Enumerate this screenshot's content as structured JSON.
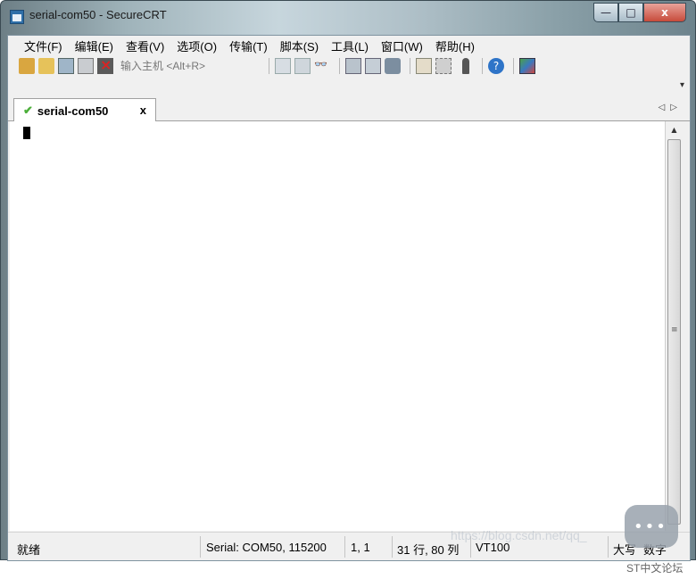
{
  "window": {
    "title": "serial-com50 - SecureCRT",
    "controls": {
      "minimize": "—",
      "maximize": "□",
      "close": "x"
    }
  },
  "menubar": {
    "items": [
      "文件(F)",
      "编辑(E)",
      "查看(V)",
      "选项(O)",
      "传输(T)",
      "脚本(S)",
      "工具(L)",
      "窗口(W)",
      "帮助(H)"
    ]
  },
  "toolbar": {
    "host_placeholder": "输入主机 <Alt+R>"
  },
  "tabs": [
    {
      "label": "serial-com50",
      "status_icon": "check-icon",
      "close": "x"
    }
  ],
  "tab_nav": {
    "prev": "◁",
    "next": "▷"
  },
  "status": {
    "ready": "就绪",
    "serial": "Serial: COM50, 115200",
    "position": "1,   1",
    "rowcol": "31 行, 80 列",
    "terminal": "VT100",
    "caps": "大写",
    "num": "数字"
  },
  "watermark": "https://blog.csdn.net/qq_",
  "footer_mark": "ST中文论坛",
  "colors": {
    "tab_check": "#4caf3a",
    "close_button": "#c74b3b",
    "terminal_bg": "#ffffff"
  }
}
